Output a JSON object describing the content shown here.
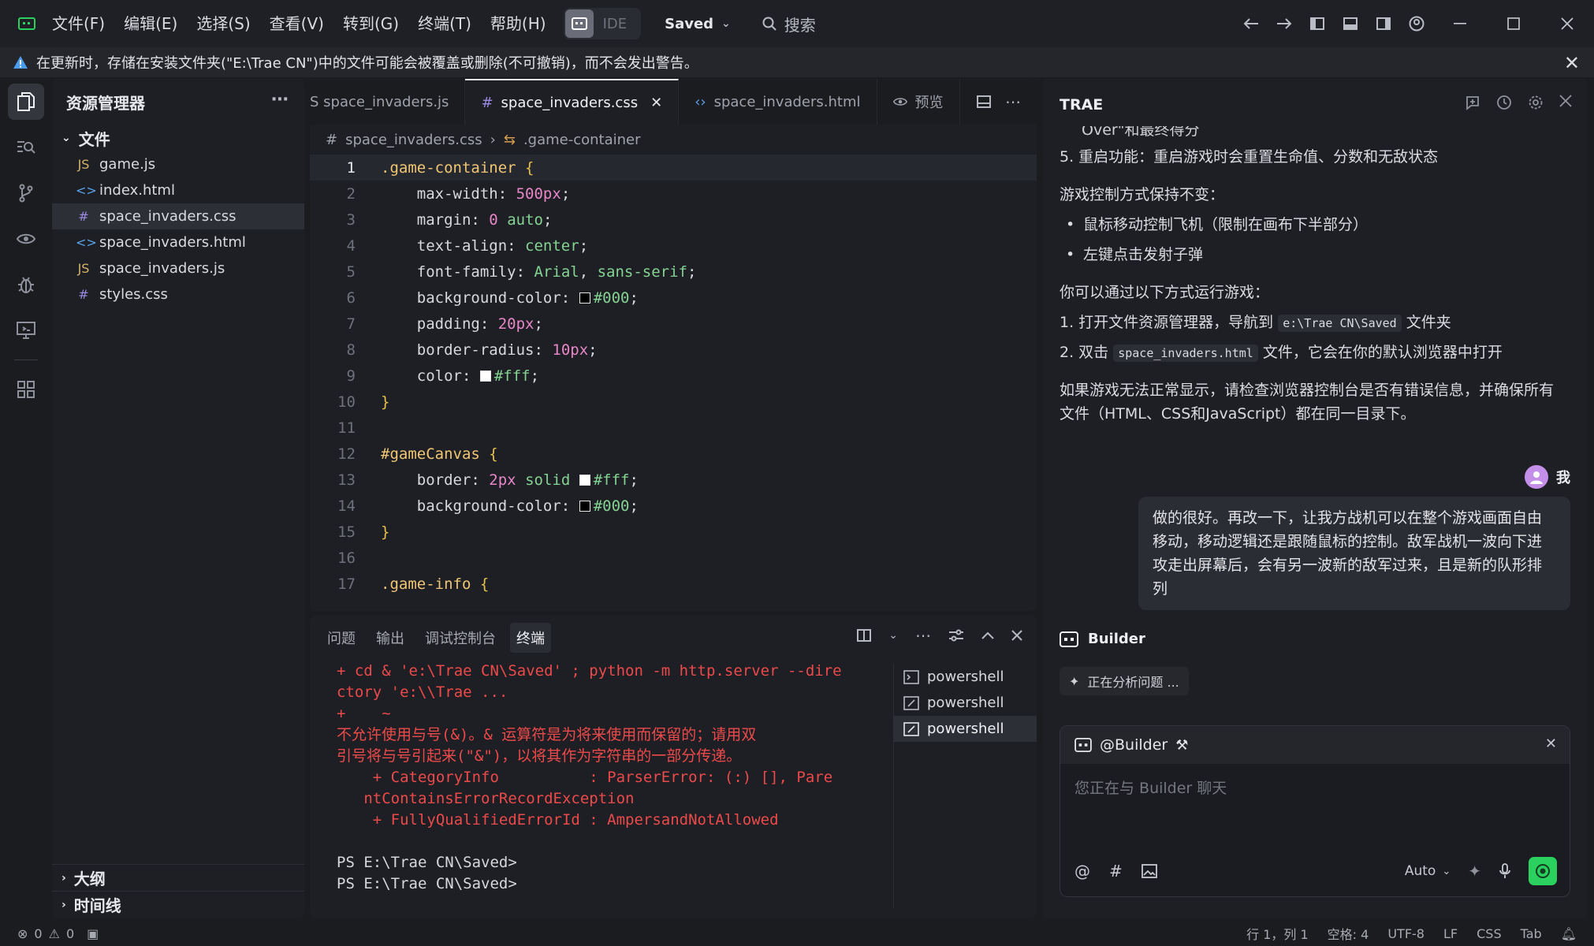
{
  "titlebar": {
    "menus": [
      "文件(F)",
      "编辑(E)",
      "选择(S)",
      "查看(V)",
      "转到(G)",
      "终端(T)",
      "帮助(H)"
    ],
    "mode_label": "IDE",
    "saved_label": "Saved",
    "search_label": "搜索"
  },
  "warning": {
    "text": "在更新时，存储在安装文件夹(\"E:\\Trae CN\")中的文件可能会被覆盖或删除(不可撤销)，而不会发出警告。"
  },
  "explorer": {
    "title": "资源管理器",
    "folder": "文件",
    "files": [
      {
        "type": "JS",
        "name": "game.js"
      },
      {
        "type": "<>",
        "name": "index.html"
      },
      {
        "type": "#",
        "name": "space_invaders.css"
      },
      {
        "type": "<>",
        "name": "space_invaders.html"
      },
      {
        "type": "JS",
        "name": "space_invaders.js"
      },
      {
        "type": "#",
        "name": "styles.css"
      }
    ],
    "outline": "大纲",
    "timeline": "时间线"
  },
  "editor": {
    "tabs": [
      "S space_invaders.js",
      "space_invaders.css",
      "space_invaders.html",
      "预览"
    ],
    "breadcrumb": [
      "space_invaders.css",
      ".game-container"
    ],
    "line_numbers": [
      "1",
      "2",
      "3",
      "4",
      "5",
      "6",
      "7",
      "8",
      "9",
      "10",
      "11",
      "12",
      "13",
      "14",
      "15",
      "16",
      "17"
    ],
    "code": {
      "l1_sel": ".game-container",
      "l2_prop": "max-width",
      "l2_val": "500px",
      "l3_prop": "margin",
      "l3_val1": "0",
      "l3_val2": "auto",
      "l4_prop": "text-align",
      "l4_val": "center",
      "l5_prop": "font-family",
      "l5_val1": "Arial",
      "l5_val2": "sans-serif",
      "l6_prop": "background-color",
      "l6_val": "#000",
      "l7_prop": "padding",
      "l7_val": "20px",
      "l8_prop": "border-radius",
      "l8_val": "10px",
      "l9_prop": "color",
      "l9_val": "#fff",
      "l12_sel": "#gameCanvas",
      "l13_prop": "border",
      "l13_val1": "2px",
      "l13_val2": "solid",
      "l13_val3": "#fff",
      "l14_prop": "background-color",
      "l14_val": "#000",
      "l17_sel": ".game-info"
    }
  },
  "panel": {
    "tabs": [
      "问题",
      "输出",
      "调试控制台",
      "终端"
    ],
    "terminal_lines": [
      "+ cd & 'e:\\Trae CN\\Saved' ; python -m http.server --dire",
      "ctory 'e:\\\\Trae ...",
      "+    ~",
      "不允许使用与号(&)。& 运算符是为将来使用而保留的；请用双",
      "引号将与号引起来(\"&\")，以将其作为字符串的一部分传递。",
      "    + CategoryInfo          : ParserError: (:) [], Pare",
      "   ntContainsErrorRecordException",
      "    + FullyQualifiedErrorId : AmpersandNotAllowed",
      "",
      "PS E:\\Trae CN\\Saved>",
      "PS E:\\Trae CN\\Saved>"
    ],
    "terminals": [
      "powershell",
      "powershell",
      "powershell"
    ]
  },
  "chat": {
    "title": "TRAE",
    "partial_top": "Over\"和最终得分",
    "item5": "5. 重启功能：重启游戏时会重置生命值、分数和无敌状态",
    "controls_intro": "游戏控制方式保持不变：",
    "bullet1": "鼠标移动控制飞机（限制在画布下半部分）",
    "bullet2": "左键点击发射子弹",
    "run_intro": "你可以通过以下方式运行游戏：",
    "step1_pre": "1. 打开文件资源管理器，导航到",
    "step1_code": "e:\\Trae CN\\Saved",
    "step1_post": "文件夹",
    "step2_pre": "2. 双击",
    "step2_code": "space_invaders.html",
    "step2_post": "文件，它会在你的默认浏览器中打开",
    "note_l1": "如果游戏无法正常显示，请检查浏览器控制台是否有错误信息，并确保所有",
    "note_l2": "文件（HTML、CSS和JavaScript）都在同一目录下。",
    "me_label": "我",
    "user_message": "做的很好。再改一下，让我方战机可以在整个游戏画面自由移动，移动逻辑还是跟随鼠标的控制。敌军战机一波向下进攻走出屏幕后，会有另一波新的敌军过来，且是新的队形排列",
    "builder_label": "Builder",
    "analyzing": "正在分析问题 ...",
    "input_agent": "@Builder",
    "input_placeholder": "您正在与 Builder 聊天",
    "model": "Auto"
  },
  "status": {
    "errors": "0",
    "warnings": "0",
    "position": "行 1，列 1",
    "spaces": "空格: 4",
    "encoding": "UTF-8",
    "eol": "LF",
    "language": "CSS",
    "tab": "Tab"
  },
  "colors": {
    "accent_green": "#2bd15f",
    "error_red": "#ec4a4a",
    "warn_blue": "#4a9cf0"
  }
}
